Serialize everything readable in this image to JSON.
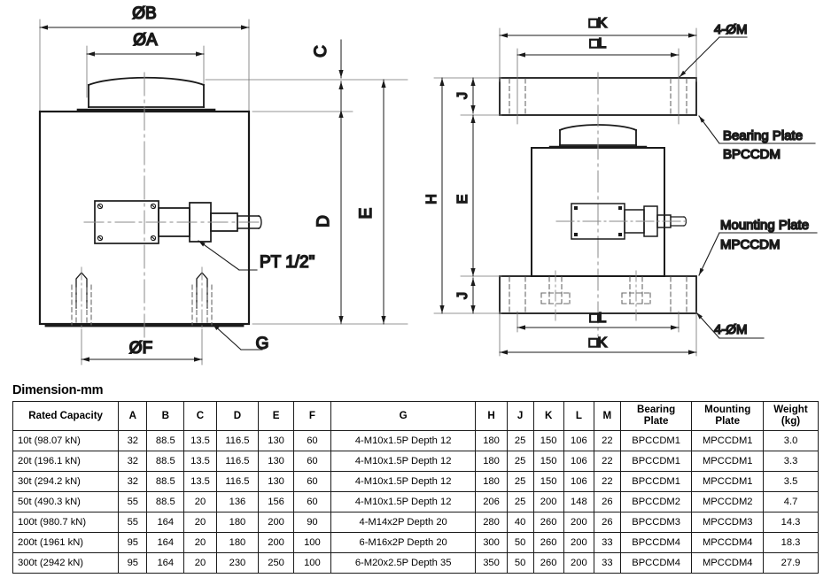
{
  "drawing": {
    "left_view": {
      "labels": {
        "diameter_b": "ØB",
        "diameter_a": "ØA",
        "dim_c": "C",
        "dim_d": "D",
        "dim_e": "E",
        "diameter_f": "ØF",
        "dim_g": "G",
        "thread_note": "PT 1/2\""
      }
    },
    "right_view": {
      "labels": {
        "square_k_top": "□K",
        "square_l_top": "□L",
        "square_l_bottom": "□L",
        "square_k_bottom": "□K",
        "holes_top": "4-ØM",
        "holes_bottom": "4-ØM",
        "dim_h": "H",
        "dim_e": "E",
        "dim_j_top": "J",
        "dim_j_bottom": "J",
        "bearing_plate_name": "Bearing Plate",
        "bearing_plate_code": "BPCCDM",
        "mounting_plate_name": "Mounting Plate",
        "mounting_plate_code": "MPCCDM"
      }
    }
  },
  "table": {
    "title": "Dimension-mm",
    "headers": [
      "Rated Capacity",
      "A",
      "B",
      "C",
      "D",
      "E",
      "F",
      "G",
      "H",
      "J",
      "K",
      "L",
      "M",
      "Bearing\nPlate",
      "Mounting\nPlate",
      "Weight\n(kg)"
    ],
    "headers_multiline": {
      "bearing_plate": [
        "Bearing",
        "Plate"
      ],
      "mounting_plate": [
        "Mounting",
        "Plate"
      ],
      "weight": [
        "Weight",
        "(kg)"
      ]
    },
    "rows": [
      {
        "capacity": "10t (98.07 kN)",
        "A": "32",
        "B": "88.5",
        "C": "13.5",
        "D": "116.5",
        "E": "130",
        "F": "60",
        "G": "4-M10x1.5P Depth 12",
        "H": "180",
        "J": "25",
        "K": "150",
        "L": "106",
        "M": "22",
        "bearing_plate": "BPCCDM1",
        "mounting_plate": "MPCCDM1",
        "weight": "3.0"
      },
      {
        "capacity": "20t (196.1 kN)",
        "A": "32",
        "B": "88.5",
        "C": "13.5",
        "D": "116.5",
        "E": "130",
        "F": "60",
        "G": "4-M10x1.5P Depth 12",
        "H": "180",
        "J": "25",
        "K": "150",
        "L": "106",
        "M": "22",
        "bearing_plate": "BPCCDM1",
        "mounting_plate": "MPCCDM1",
        "weight": "3.3"
      },
      {
        "capacity": "30t (294.2 kN)",
        "A": "32",
        "B": "88.5",
        "C": "13.5",
        "D": "116.5",
        "E": "130",
        "F": "60",
        "G": "4-M10x1.5P Depth 12",
        "H": "180",
        "J": "25",
        "K": "150",
        "L": "106",
        "M": "22",
        "bearing_plate": "BPCCDM1",
        "mounting_plate": "MPCCDM1",
        "weight": "3.5"
      },
      {
        "capacity": "50t (490.3 kN)",
        "A": "55",
        "B": "88.5",
        "C": "20",
        "D": "136",
        "E": "156",
        "F": "60",
        "G": "4-M10x1.5P Depth 12",
        "H": "206",
        "J": "25",
        "K": "200",
        "L": "148",
        "M": "26",
        "bearing_plate": "BPCCDM2",
        "mounting_plate": "MPCCDM2",
        "weight": "4.7"
      },
      {
        "capacity": "100t (980.7 kN)",
        "A": "55",
        "B": "164",
        "C": "20",
        "D": "180",
        "E": "200",
        "F": "90",
        "G": "4-M14x2P Depth 20",
        "H": "280",
        "J": "40",
        "K": "260",
        "L": "200",
        "M": "26",
        "bearing_plate": "BPCCDM3",
        "mounting_plate": "MPCCDM3",
        "weight": "14.3"
      },
      {
        "capacity": "200t (1961 kN)",
        "A": "95",
        "B": "164",
        "C": "20",
        "D": "180",
        "E": "200",
        "F": "100",
        "G": "6-M16x2P Depth 20",
        "H": "300",
        "J": "50",
        "K": "260",
        "L": "200",
        "M": "33",
        "bearing_plate": "BPCCDM4",
        "mounting_plate": "MPCCDM4",
        "weight": "18.3"
      },
      {
        "capacity": "300t (2942 kN)",
        "A": "95",
        "B": "164",
        "C": "20",
        "D": "230",
        "E": "250",
        "F": "100",
        "G": "6-M20x2.5P Depth 35",
        "H": "350",
        "J": "50",
        "K": "260",
        "L": "200",
        "M": "33",
        "bearing_plate": "BPCCDM4",
        "mounting_plate": "MPCCDM4",
        "weight": "27.9"
      }
    ]
  },
  "colors": {
    "line": "#1a1a1a",
    "thin_line": "#555555",
    "center_line": "#888888",
    "background": "#ffffff"
  }
}
